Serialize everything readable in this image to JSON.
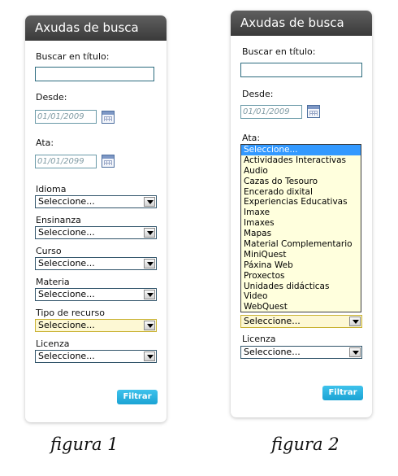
{
  "figure1": {
    "panel_title": "Axudas de busca",
    "buscar_label": "Buscar en título:",
    "buscar_value": "",
    "desde_label": "Desde:",
    "desde_value": "01/01/2009",
    "ata_label": "Ata:",
    "ata_value": "01/01/2099",
    "idioma_label": "Idioma",
    "idioma_value": "Seleccione...",
    "ensinanza_label": "Ensinanza",
    "ensinanza_value": "Seleccione...",
    "curso_label": "Curso",
    "curso_value": "Seleccione...",
    "materia_label": "Materia",
    "materia_value": "Seleccione...",
    "tipo_label": "Tipo de recurso",
    "tipo_value": "Seleccione...",
    "licenza_label": "Licenza",
    "licenza_value": "Seleccione...",
    "filter_button": "Filtrar",
    "caption": "figura 1"
  },
  "figure2": {
    "panel_title": "Axudas de busca",
    "buscar_label": "Buscar en título:",
    "buscar_value": "",
    "desde_label": "Desde:",
    "desde_value": "01/01/2009",
    "ata_label": "Ata:",
    "dropdown_options": [
      "Seleccione...",
      "Actividades Interactivas",
      "Audio",
      "Cazas do Tesouro",
      "Encerado dixital",
      "Experiencias Educativas",
      "Imaxe",
      "Imaxes",
      "Mapas",
      "Material Complementario",
      "MiniQuest",
      "Páxina Web",
      "Proxectos",
      "Unidades didácticas",
      "Video",
      "WebQuest"
    ],
    "dropdown_selected_index": 0,
    "tipo_value": "Seleccione...",
    "licenza_label": "Licenza",
    "licenza_value": "Seleccione...",
    "filter_button": "Filtrar",
    "caption": "figura 2"
  },
  "colors": {
    "header_dark": "#3a3a3a",
    "button_blue": "#1ba3d4",
    "select_highlight": "#3399ff",
    "focus_yellow": "#fdf8d4"
  },
  "icons": {
    "calendar": "calendar-icon",
    "select_arrow": "chevron-down-icon"
  }
}
